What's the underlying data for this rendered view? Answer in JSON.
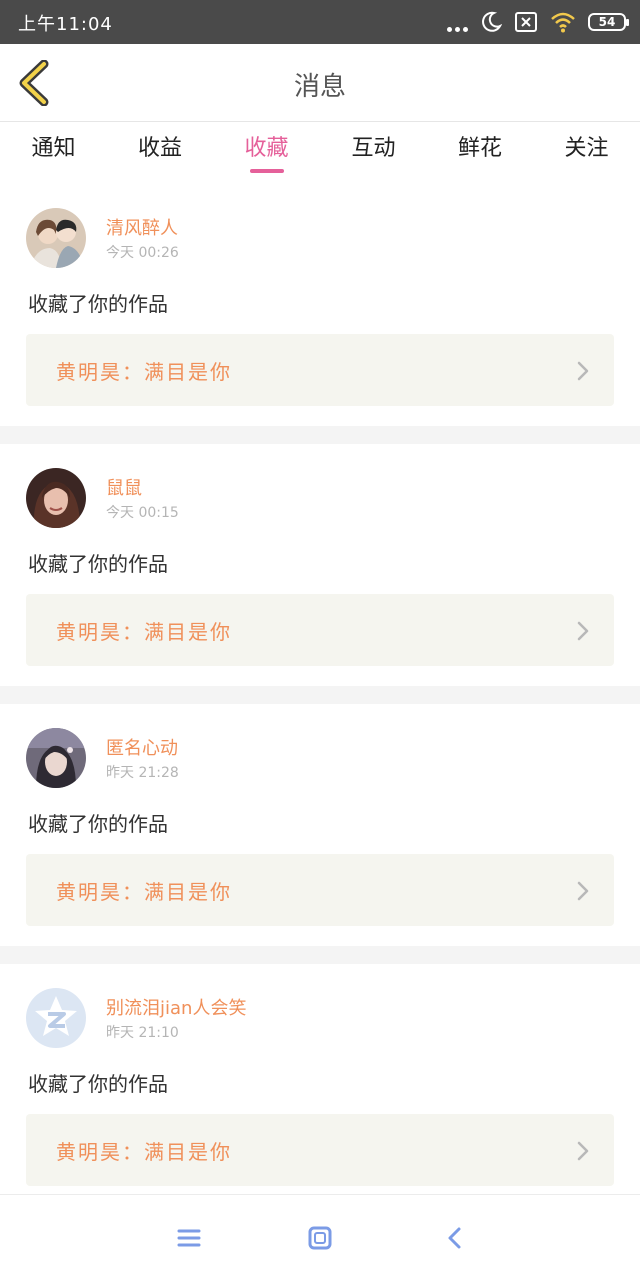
{
  "status_bar": {
    "time": "上午11:04",
    "battery": "54"
  },
  "header": {
    "title": "消息"
  },
  "tabs": [
    {
      "label": "通知"
    },
    {
      "label": "收益"
    },
    {
      "label": "收藏",
      "active": true
    },
    {
      "label": "互动"
    },
    {
      "label": "鲜花"
    },
    {
      "label": "关注"
    }
  ],
  "items": [
    {
      "user": "清风醉人",
      "time": "今天 00:26",
      "action": "收藏了你的作品",
      "work": "黄明昊：满目是你"
    },
    {
      "user": "鼠鼠",
      "time": "今天 00:15",
      "action": "收藏了你的作品",
      "work": "黄明昊：满目是你"
    },
    {
      "user": "匿名心动",
      "time": "昨天 21:28",
      "action": "收藏了你的作品",
      "work": "黄明昊：满目是你"
    },
    {
      "user": "别流泪jian人会笑",
      "time": "昨天 21:10",
      "action": "收藏了你的作品",
      "work": "黄明昊：满目是你"
    }
  ],
  "colors": {
    "accent": "#e5609a",
    "username": "#f0905a",
    "work_bg": "#f5f5ef",
    "status_bar": "#4a4a4a",
    "nav_icon": "#7b9be6"
  },
  "icons": {
    "back": "chevron-left-icon",
    "moon": "moon-icon",
    "wifi": "wifi-icon",
    "sim": "no-sim-icon",
    "chevron": "chevron-right-icon",
    "menu": "menu-icon",
    "home": "home-icon",
    "nav_back": "back-icon"
  }
}
